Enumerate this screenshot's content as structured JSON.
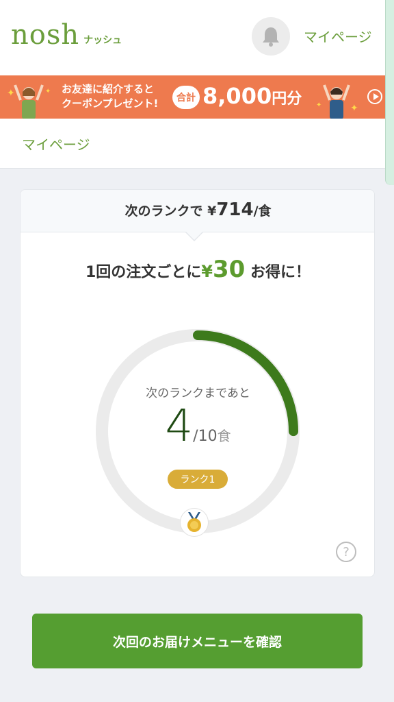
{
  "header": {
    "logo_text": "nosh",
    "logo_kana": "ナッシュ",
    "notification_icon": "bell-icon",
    "mypage_link": "マイページ"
  },
  "banner": {
    "line1": "お友達に紹介すると",
    "line2": "クーポンプレゼント!",
    "pill": "合計",
    "amount": "8,000",
    "amount_unit": "円分",
    "play_icon": "play-icon",
    "color": "#ee7a4e"
  },
  "subnav": {
    "title": "マイページ"
  },
  "rank_card": {
    "head_prefix": "次のランクで",
    "head_yen": "¥",
    "head_price": "714",
    "head_suffix": "/食",
    "benefit_prefix": "1回の注文ごとに",
    "benefit_yen": "¥",
    "benefit_amount": "30",
    "benefit_suffix": "お得に！",
    "ring_label": "次のランクまであと",
    "remaining": "4",
    "total": "/10",
    "unit": "食",
    "progress_fraction": 0.25,
    "rank_badge": "ランク1",
    "medal_icon": "medal-icon",
    "help_icon": "help-icon",
    "help_symbol": "?",
    "accent_color": "#3d7a1c"
  },
  "cta": {
    "label": "次回のお届けメニューを確認",
    "color": "#559e31"
  }
}
